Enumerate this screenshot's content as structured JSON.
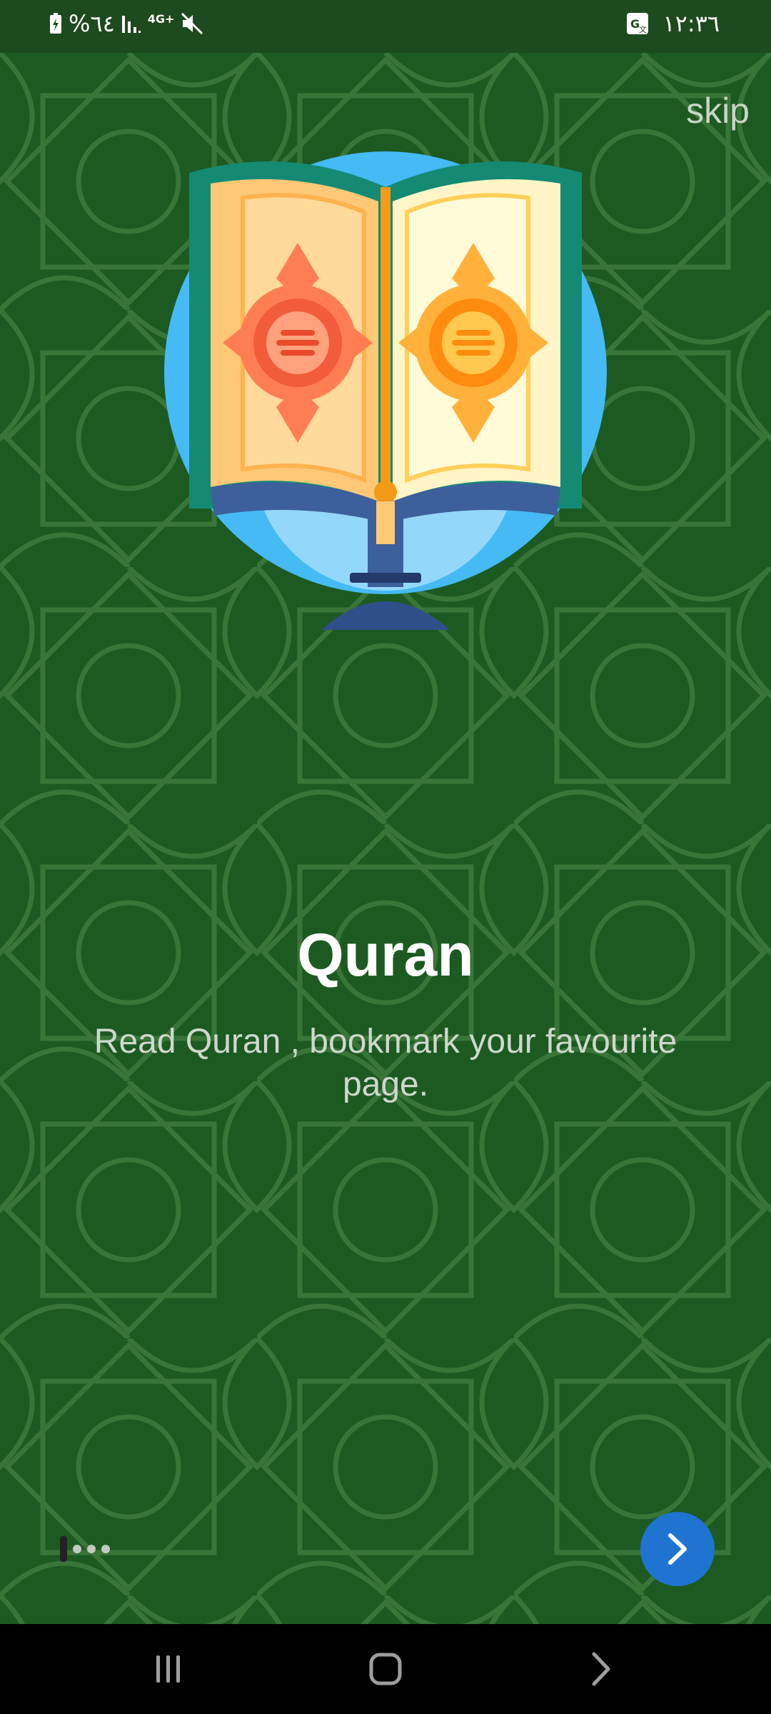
{
  "status_bar": {
    "battery_text": "%٦٤",
    "network_text": "4G+",
    "time": "١٢:٣٦"
  },
  "onboarding": {
    "skip_label": "skip",
    "title": "Quran",
    "description": "Read  Quran , bookmark your favourite page.",
    "page_count": 4,
    "current_page": 1
  },
  "colors": {
    "background_green": "#1c5a22",
    "accent_blue": "#1f74d2",
    "circle_blue": "#45baf5"
  },
  "icons": {
    "next": "chevron-right-icon",
    "recents": "recents-icon",
    "home": "home-icon",
    "back": "back-icon"
  }
}
